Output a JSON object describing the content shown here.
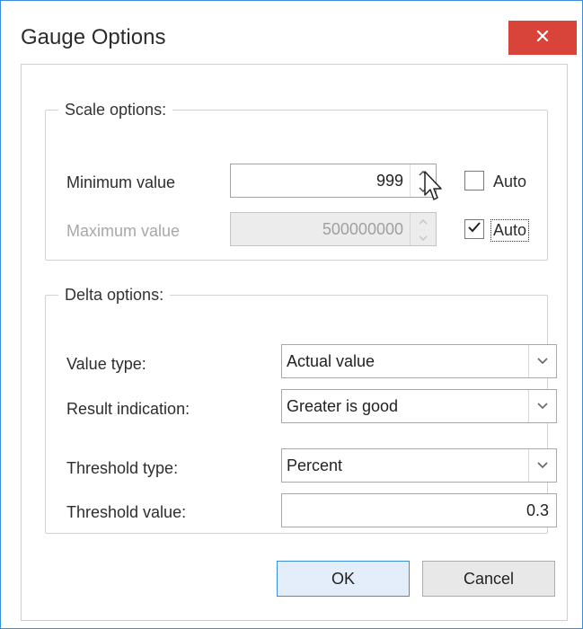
{
  "window": {
    "title": "Gauge Options"
  },
  "scale": {
    "legend": "Scale options:",
    "min_label": "Minimum value",
    "min_value": "999",
    "min_auto_label": "Auto",
    "min_auto_checked": false,
    "max_label": "Maximum value",
    "max_value": "500000000",
    "max_auto_label": "Auto",
    "max_auto_checked": true
  },
  "delta": {
    "legend": "Delta options:",
    "value_type_label": "Value type:",
    "value_type": "Actual value",
    "result_indication_label": "Result indication:",
    "result_indication": "Greater is good",
    "threshold_type_label": "Threshold type:",
    "threshold_type": "Percent",
    "threshold_value_label": "Threshold value:",
    "threshold_value": "0.3"
  },
  "buttons": {
    "ok": "OK",
    "cancel": "Cancel"
  },
  "icons": {
    "close": "close-icon",
    "spin_up": "spin-up-icon",
    "spin_down": "spin-down-icon",
    "check": "checkmark-icon",
    "dropdown": "chevron-down-icon",
    "cursor": "mouse-pointer-icon"
  },
  "colors": {
    "close_button": "#d9443a",
    "window_border": "#3b8ed8",
    "default_button_border": "#3c8ee0"
  }
}
